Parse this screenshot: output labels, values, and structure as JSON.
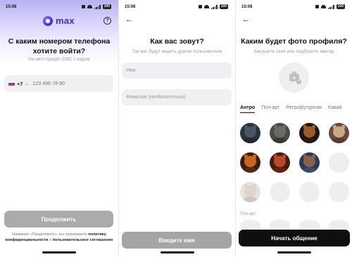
{
  "status_bar": {
    "time": "15:08",
    "battery": "100"
  },
  "screen1": {
    "logo_text": "max",
    "help_icon": "?",
    "title": "С каким номером телефона хотите войти?",
    "subtitle": "На него придёт СМС с кодом",
    "country_code": "+7",
    "phone_placeholder": "123 456-78-90",
    "continue_button": "Продолжить",
    "terms_prefix": "Нажимая «Продолжить», вы принимаете",
    "terms_link1": "политику конфиденциальности",
    "terms_and": "и",
    "terms_link2": "пользовательское соглашение"
  },
  "screen2": {
    "title": "Как вас зовут?",
    "subtitle": "Так вас будут видеть другие пользователи",
    "name_placeholder": "Имя",
    "surname_placeholder": "Фамилия (необязательно)",
    "submit_button": "Введите имя"
  },
  "screen3": {
    "title": "Каким будет фото профиля?",
    "subtitle": "Загрузите своё или подберите аватар",
    "tabs": [
      "Антро",
      "Поп-арт",
      "Ретрофутуризм",
      "Кавай"
    ],
    "active_tab": "Антро",
    "section_label": "Поп-арт",
    "start_button": "Начать общение"
  },
  "icons": {
    "back": "arrow-left-icon",
    "help": "question-circle-icon",
    "camera": "camera-plus-icon"
  },
  "colors": {
    "brand": "#3a2fc8",
    "disabled_button": "#ababab",
    "primary_button": "#0f0f0f",
    "field_bg": "#f0f0f3"
  }
}
